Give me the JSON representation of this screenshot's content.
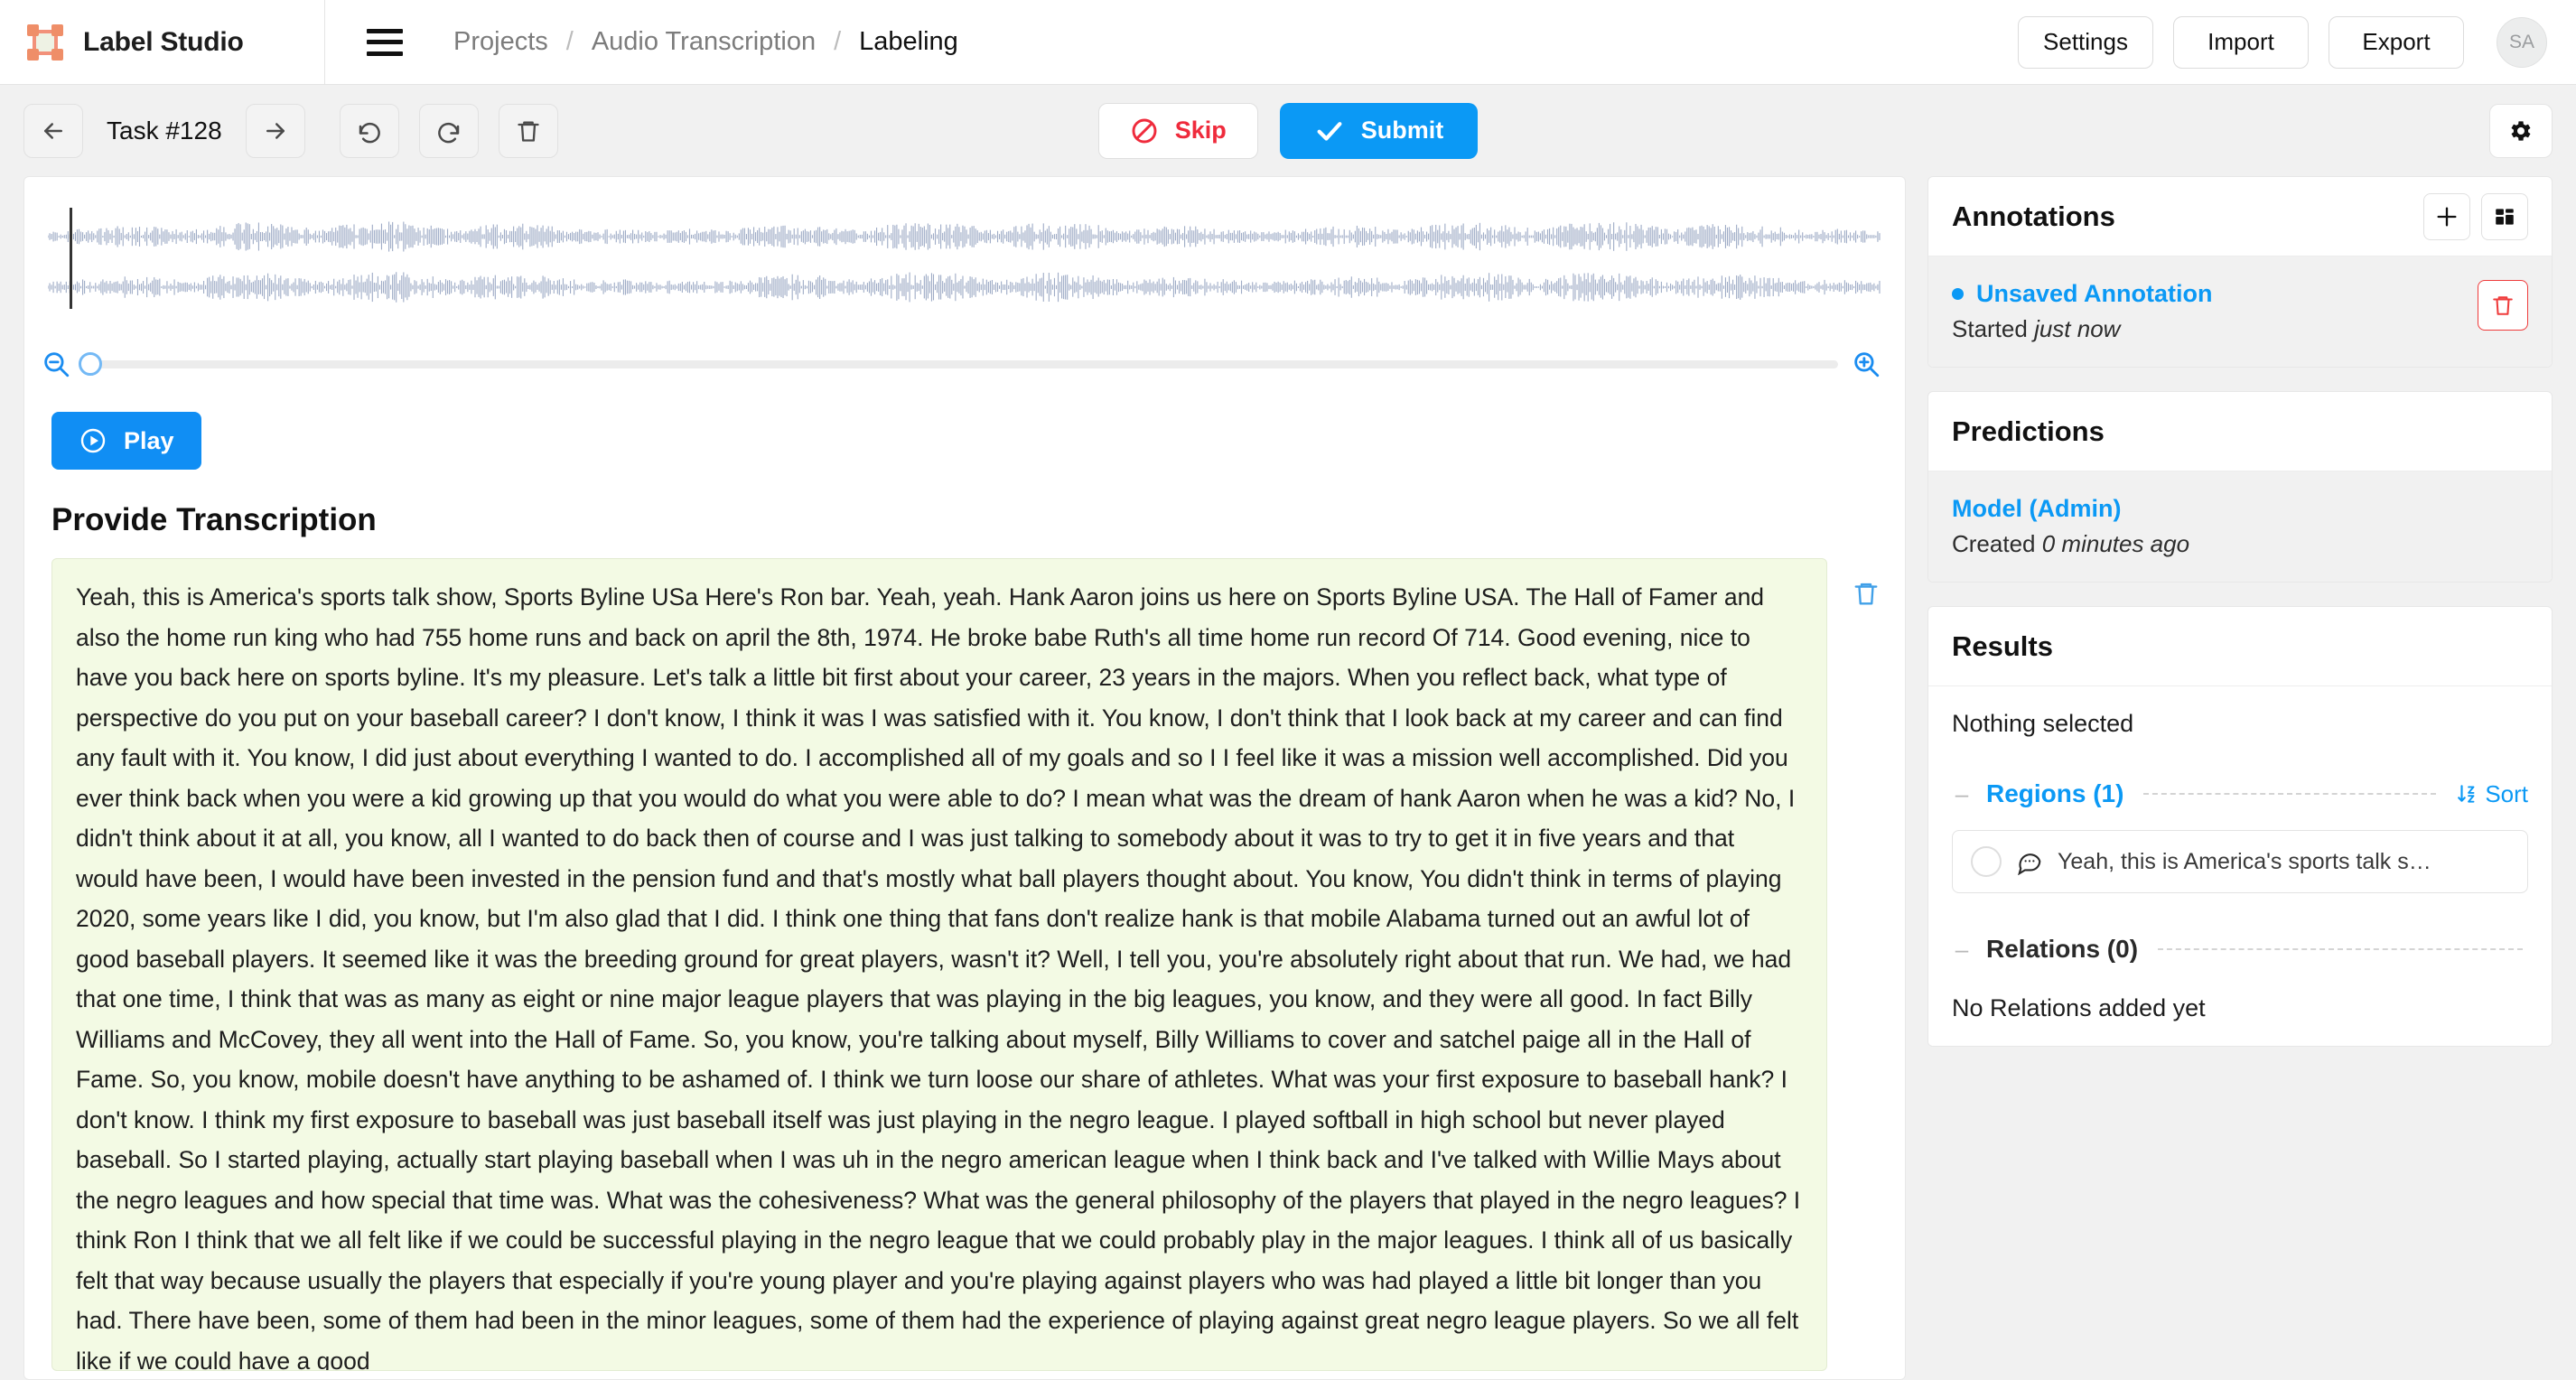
{
  "header": {
    "brand_name": "Label Studio",
    "logo_icon": "label-studio-logo",
    "menu_icon": "hamburger-menu-icon",
    "breadcrumbs": [
      {
        "label": "Projects",
        "current": false
      },
      {
        "label": "Audio Transcription",
        "current": false
      },
      {
        "label": "Labeling",
        "current": true
      }
    ],
    "separator": "/",
    "settings_label": "Settings",
    "import_label": "Import",
    "export_label": "Export",
    "avatar_initials": "SA"
  },
  "toolbar": {
    "prev_icon": "arrow-left-icon",
    "task_label": "Task #128",
    "next_icon": "arrow-right-icon",
    "undo_icon": "undo-icon",
    "redo_icon": "redo-icon",
    "reset_icon": "trash-icon",
    "skip_label": "Skip",
    "skip_icon": "prohibited-icon",
    "submit_label": "Submit",
    "submit_icon": "check-icon",
    "settings_icon": "gear-icon",
    "skip_color": "#ef2b3c",
    "submit_color": "#0b99f5"
  },
  "audio": {
    "zoom_out_icon": "zoom-out-icon",
    "zoom_in_icon": "zoom-in-icon",
    "zoom_value": 0,
    "play_label": "Play",
    "play_icon": "play-circle-icon",
    "channels": 2
  },
  "transcription": {
    "section_title": "Provide Transcription",
    "delete_icon": "trash-icon",
    "background_color": "#f3fae4",
    "text": "Yeah, this is America's sports talk show, Sports Byline USa Here's Ron bar. Yeah, yeah. Hank Aaron joins us here on Sports Byline USA. The Hall of Famer and also the home run king who had 755 home runs and back on april the 8th, 1974. He broke babe Ruth's all time home run record Of 714. Good evening, nice to have you back here on sports byline. It's my pleasure. Let's talk a little bit first about your career, 23 years in the majors. When you reflect back, what type of perspective do you put on your baseball career? I don't know, I think it was I was satisfied with it. You know, I don't think that I look back at my career and can find any fault with it. You know, I did just about everything I wanted to do. I accomplished all of my goals and so I I feel like it was a mission well accomplished. Did you ever think back when you were a kid growing up that you would do what you were able to do? I mean what was the dream of hank Aaron when he was a kid? No, I didn't think about it at all, you know, all I wanted to do back then of course and I was just talking to somebody about it was to try to get it in five years and that would have been, I would have been invested in the pension fund and that's mostly what ball players thought about. You know, You didn't think in terms of playing 2020, some years like I did, you know, but I'm also glad that I did. I think one thing that fans don't realize hank is that mobile Alabama turned out an awful lot of good baseball players. It seemed like it was the breeding ground for great players, wasn't it? Well, I tell you, you're absolutely right about that run. We had, we had that one time, I think that was as many as eight or nine major league players that was playing in the big leagues, you know, and they were all good. In fact Billy Williams and McCovey, they all went into the Hall of Fame. So, you know, you're talking about myself, Billy Williams to cover and satchel paige all in the Hall of Fame. So, you know, mobile doesn't have anything to be ashamed of. I think we turn loose our share of athletes. What was your first exposure to baseball hank? I don't know. I think my first exposure to baseball was just baseball itself was just playing in the negro league. I played softball in high school but never played baseball. So I started playing, actually start playing baseball when I was uh in the negro american league when I think back and I've talked with Willie Mays about the negro leagues and how special that time was. What was the cohesiveness? What was the general philosophy of the players that played in the negro leagues? I think Ron I think that we all felt like if we could be successful playing in the negro league that we could probably play in the major leagues. I think all of us basically felt that way because usually the players that especially if you're young player and you're playing against players who was had played a little bit longer than you had. There have been, some of them had been in the minor leagues, some of them had the experience of playing against great negro league players. So we all felt like if we could have a good"
  },
  "annotations": {
    "title": "Annotations",
    "add_icon": "plus-icon",
    "grid_icon": "grid-view-icon",
    "item_name": "Unsaved Annotation",
    "item_status_prefix": "Started",
    "item_status_time": "just now",
    "delete_icon": "trash-icon"
  },
  "predictions": {
    "title": "Predictions",
    "item_name": "Model (Admin)",
    "item_status_prefix": "Created",
    "item_status_time": "0 minutes ago"
  },
  "results": {
    "title": "Results",
    "nothing_selected": "Nothing selected",
    "regions_label": "Regions (1)",
    "regions_collapse_icon": "minus-icon",
    "sort_label": "Sort",
    "sort_icon": "sort-alpha-icon",
    "region_items": [
      {
        "text": "Yeah, this is America's sports talk s…",
        "icon": "speech-bubble-icon"
      }
    ],
    "relations_label": "Relations (0)",
    "relations_collapse_icon": "minus-icon",
    "relations_empty": "No Relations added yet"
  }
}
